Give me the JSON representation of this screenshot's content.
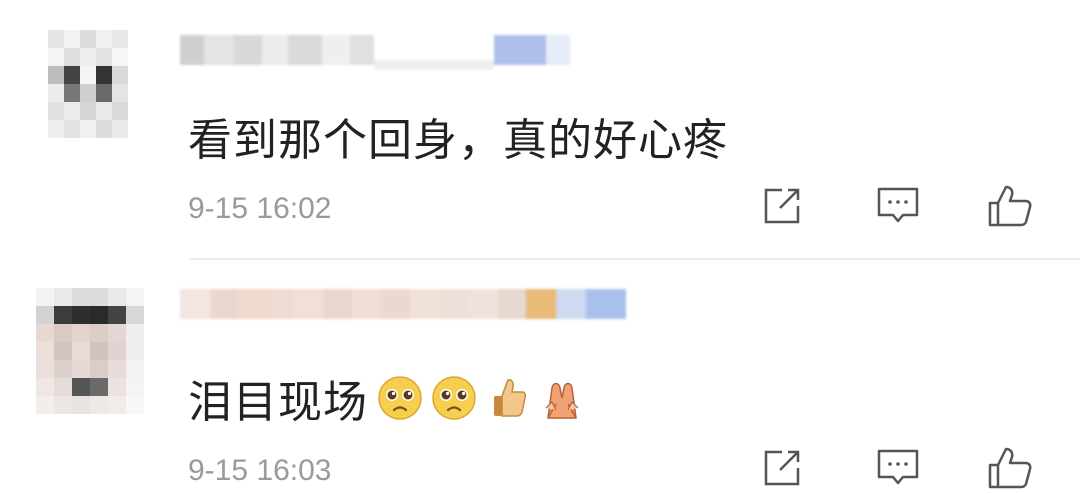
{
  "comments": [
    {
      "text": "看到那个回身，真的好心疼",
      "emojis": [],
      "time": "9-15 16:02"
    },
    {
      "text": "泪目现场",
      "emojis": [
        "pleading-face",
        "pleading-face",
        "thumbs-up",
        "folded-hands"
      ],
      "time": "9-15 16:03"
    }
  ],
  "icons": {
    "share": "share-icon",
    "reply": "comment-icon",
    "like": "thumbs-up-icon"
  },
  "colors": {
    "text": "#222222",
    "time": "#9a9a9a",
    "icon": "#555555",
    "divider": "#ececec"
  }
}
